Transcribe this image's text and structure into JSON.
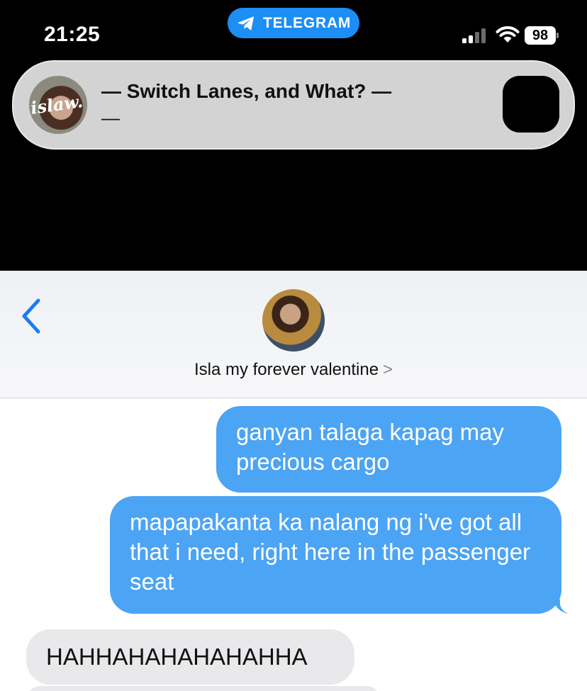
{
  "status_bar": {
    "time": "21:25",
    "app_pill": "TELEGRAM",
    "battery": "98",
    "accent_color": "#1c8ef5",
    "icons": [
      "telegram-icon",
      "signal-icon",
      "wifi-icon",
      "battery-icon"
    ]
  },
  "now_playing": {
    "art_text": "islaw.",
    "title": "— Switch Lanes, and What? —",
    "subtitle": "—"
  },
  "conversation": {
    "contact_name": "Isla my forever valentine",
    "contact_chevron": ">",
    "sent_color": "#4ca4f4",
    "received_color": "#e9e9eb",
    "messages": [
      {
        "direction": "sent",
        "text": "ganyan talaga kapag may precious cargo"
      },
      {
        "direction": "sent",
        "text": "mapapakanta ka nalang ng i've got all that i need, right here in the passenger seat"
      },
      {
        "direction": "received",
        "text": "HAHHAHAHAHAHAHHA"
      }
    ]
  }
}
